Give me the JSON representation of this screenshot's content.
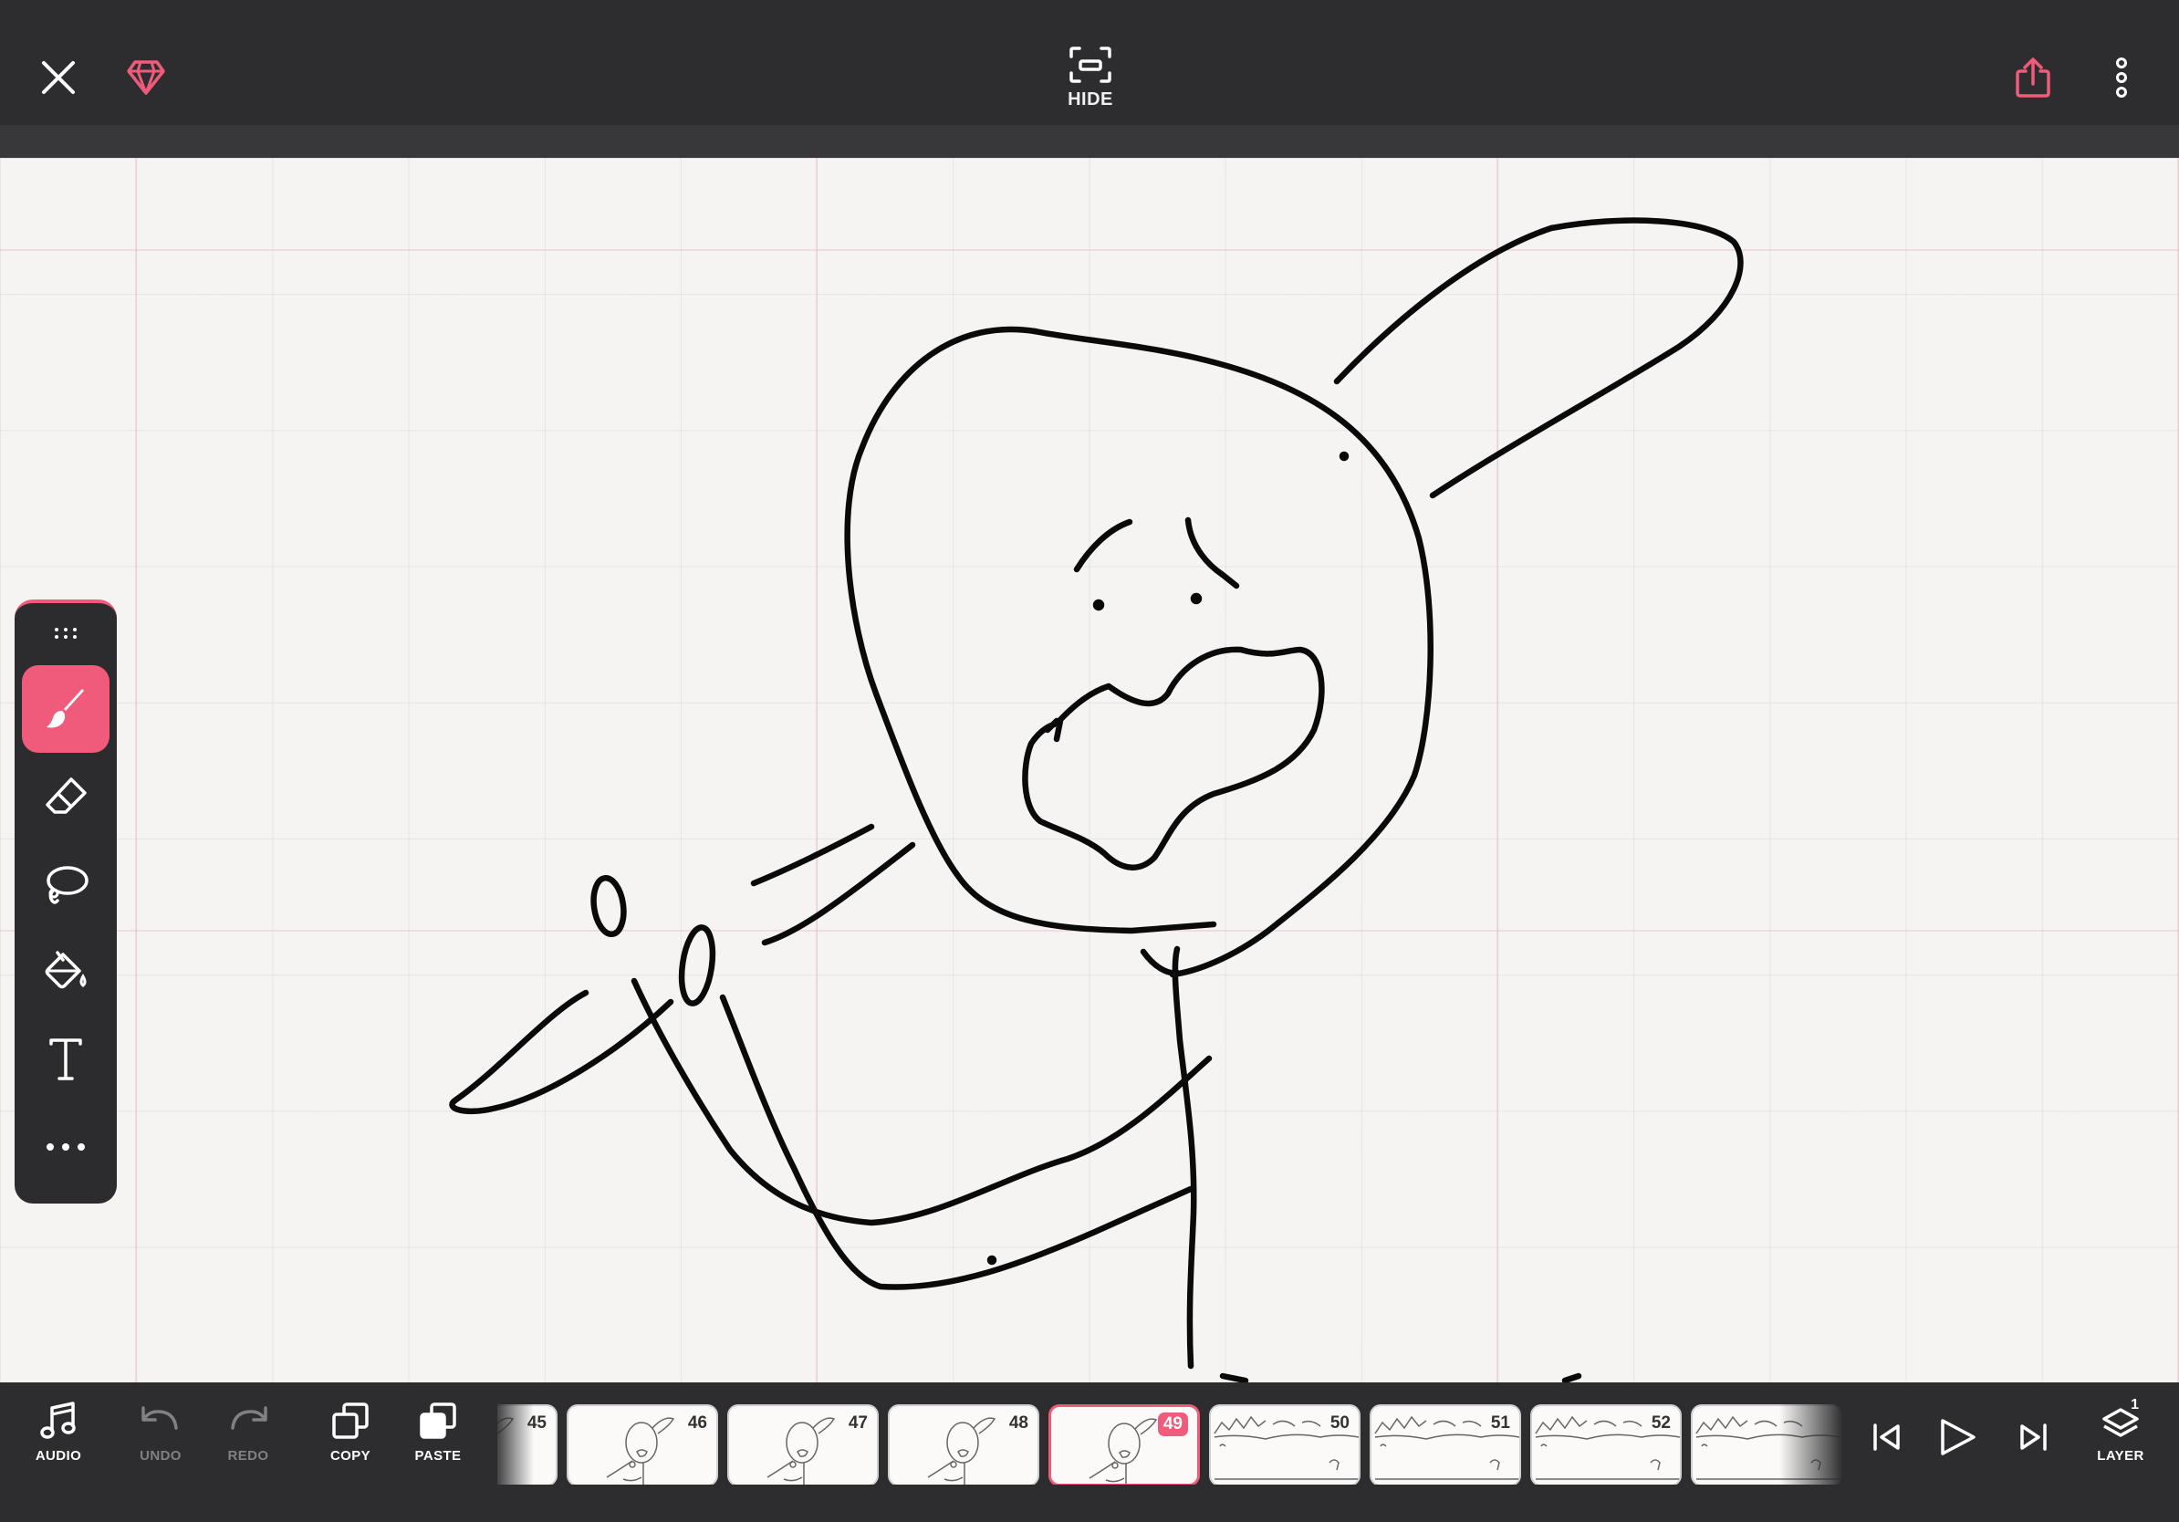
{
  "topbar": {
    "hide_label": "HIDE",
    "icons": [
      "close-icon",
      "premium-gem-icon",
      "hide-ui-icon",
      "share-icon",
      "more-vertical-icon"
    ],
    "accent_color": "#f15b7b"
  },
  "palette": {
    "tools": [
      "brush",
      "eraser",
      "lasso",
      "fill",
      "text",
      "more"
    ],
    "active_tool": "brush"
  },
  "bottombar": {
    "audio_label": "AUDIO",
    "undo_label": "UNDO",
    "redo_label": "REDO",
    "copy_label": "COPY",
    "paste_label": "PASTE",
    "layer_label": "LAYER",
    "layer_count": "1"
  },
  "frames": [
    {
      "number": "45",
      "thumb": "character"
    },
    {
      "number": "46",
      "thumb": "character"
    },
    {
      "number": "47",
      "thumb": "character"
    },
    {
      "number": "48",
      "thumb": "character"
    },
    {
      "number": "49",
      "thumb": "character",
      "active": true
    },
    {
      "number": "50",
      "thumb": "landscape"
    },
    {
      "number": "51",
      "thumb": "landscape"
    },
    {
      "number": "52",
      "thumb": "landscape"
    },
    {
      "number": "",
      "thumb": "landscape"
    }
  ],
  "current_frame": "49"
}
